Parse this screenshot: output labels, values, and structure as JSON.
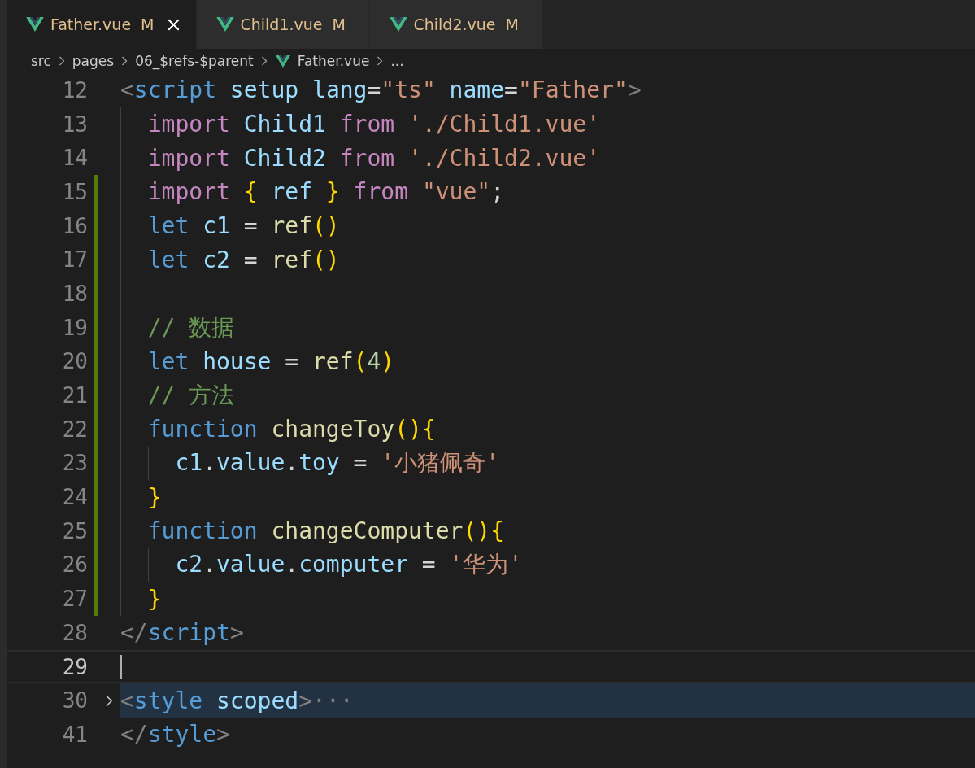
{
  "tabs": [
    {
      "label": "Father.vue",
      "status": "M",
      "selected": true,
      "closable": true
    },
    {
      "label": "Child1.vue",
      "status": "M",
      "selected": false,
      "closable": false
    },
    {
      "label": "Child2.vue",
      "status": "M",
      "selected": false,
      "closable": false
    }
  ],
  "breadcrumb": [
    {
      "label": "src",
      "kind": "folder"
    },
    {
      "label": "pages",
      "kind": "folder"
    },
    {
      "label": "06_$refs-$parent",
      "kind": "folder"
    },
    {
      "label": "Father.vue",
      "kind": "vue"
    },
    {
      "label": "...",
      "kind": "more"
    }
  ],
  "lines": [
    {
      "number": "12",
      "changed": false,
      "current": false,
      "folded": false,
      "tokens": [
        {
          "kind": "punct",
          "text": "<"
        },
        {
          "kind": "tag",
          "text": "script"
        },
        {
          "kind": "attr",
          "text": " setup"
        },
        {
          "kind": "attr",
          "text": " lang"
        },
        {
          "kind": "plain",
          "text": "="
        },
        {
          "kind": "string",
          "text": "\"ts\""
        },
        {
          "kind": "attr",
          "text": " name"
        },
        {
          "kind": "plain",
          "text": "="
        },
        {
          "kind": "string",
          "text": "\"Father\""
        },
        {
          "kind": "punct",
          "text": ">"
        }
      ],
      "children": [
        {
          "number": "13",
          "changed": false,
          "current": false,
          "folded": false,
          "tokens": [
            {
              "kind": "keyword",
              "text": "import"
            },
            {
              "kind": "var",
              "text": " Child1"
            },
            {
              "kind": "keyword",
              "text": " from"
            },
            {
              "kind": "string",
              "text": " './Child1.vue'"
            }
          ]
        },
        {
          "number": "14",
          "changed": false,
          "current": false,
          "folded": false,
          "tokens": [
            {
              "kind": "keyword",
              "text": "import"
            },
            {
              "kind": "var",
              "text": " Child2"
            },
            {
              "kind": "keyword",
              "text": " from"
            },
            {
              "kind": "string",
              "text": " './Child2.vue'"
            }
          ]
        },
        {
          "number": "15",
          "changed": true,
          "current": false,
          "folded": false,
          "tokens": [
            {
              "kind": "keyword",
              "text": "import"
            },
            {
              "kind": "bracket",
              "text": " {"
            },
            {
              "kind": "var",
              "text": " ref"
            },
            {
              "kind": "bracket",
              "text": " }"
            },
            {
              "kind": "keyword",
              "text": " from"
            },
            {
              "kind": "string",
              "text": " \"vue\""
            },
            {
              "kind": "plain",
              "text": ";"
            }
          ]
        },
        {
          "number": "16",
          "changed": true,
          "current": false,
          "folded": false,
          "tokens": [
            {
              "kind": "storage",
              "text": "let"
            },
            {
              "kind": "var",
              "text": " c1"
            },
            {
              "kind": "plain",
              "text": " = "
            },
            {
              "kind": "func",
              "text": "ref"
            },
            {
              "kind": "bracket",
              "text": "()"
            }
          ]
        },
        {
          "number": "17",
          "changed": true,
          "current": false,
          "folded": false,
          "tokens": [
            {
              "kind": "storage",
              "text": "let"
            },
            {
              "kind": "var",
              "text": " c2"
            },
            {
              "kind": "plain",
              "text": " = "
            },
            {
              "kind": "func",
              "text": "ref"
            },
            {
              "kind": "bracket",
              "text": "()"
            }
          ]
        },
        {
          "number": "18",
          "changed": true,
          "current": false,
          "folded": false
        },
        {
          "number": "19",
          "changed": true,
          "current": false,
          "folded": false,
          "tokens": [
            {
              "kind": "comment",
              "text": "// 数据"
            }
          ]
        },
        {
          "number": "20",
          "changed": true,
          "current": false,
          "folded": false,
          "tokens": [
            {
              "kind": "storage",
              "text": "let"
            },
            {
              "kind": "var",
              "text": " house"
            },
            {
              "kind": "plain",
              "text": " = "
            },
            {
              "kind": "func",
              "text": "ref"
            },
            {
              "kind": "bracket",
              "text": "("
            },
            {
              "kind": "number",
              "text": "4"
            },
            {
              "kind": "bracket",
              "text": ")"
            }
          ]
        },
        {
          "number": "21",
          "changed": true,
          "current": false,
          "folded": false,
          "tokens": [
            {
              "kind": "comment",
              "text": "// 方法"
            }
          ]
        },
        {
          "number": "22",
          "changed": true,
          "current": false,
          "folded": false,
          "tokens": [
            {
              "kind": "storage",
              "text": "function"
            },
            {
              "kind": "func",
              "text": " changeToy"
            },
            {
              "kind": "bracket",
              "text": "(){"
            }
          ],
          "children": [
            {
              "number": "23",
              "changed": true,
              "current": false,
              "folded": false,
              "tokens": [
                {
                  "kind": "var",
                  "text": "c1"
                },
                {
                  "kind": "plain",
                  "text": "."
                },
                {
                  "kind": "var",
                  "text": "value"
                },
                {
                  "kind": "plain",
                  "text": "."
                },
                {
                  "kind": "var",
                  "text": "toy"
                },
                {
                  "kind": "plain",
                  "text": " = "
                },
                {
                  "kind": "string",
                  "text": "'小猪佩奇'"
                }
              ]
            }
          ]
        },
        {
          "number": "24",
          "changed": true,
          "current": false,
          "folded": false,
          "tokens": [
            {
              "kind": "bracket",
              "text": "}"
            }
          ]
        },
        {
          "number": "25",
          "changed": true,
          "current": false,
          "folded": false,
          "tokens": [
            {
              "kind": "storage",
              "text": "function"
            },
            {
              "kind": "func",
              "text": " changeComputer"
            },
            {
              "kind": "bracket",
              "text": "(){"
            }
          ],
          "children": [
            {
              "number": "26",
              "changed": true,
              "current": false,
              "folded": false,
              "tokens": [
                {
                  "kind": "var",
                  "text": "c2"
                },
                {
                  "kind": "plain",
                  "text": "."
                },
                {
                  "kind": "var",
                  "text": "value"
                },
                {
                  "kind": "plain",
                  "text": "."
                },
                {
                  "kind": "var",
                  "text": "computer"
                },
                {
                  "kind": "plain",
                  "text": " = "
                },
                {
                  "kind": "string",
                  "text": "'华为'"
                }
              ]
            }
          ]
        },
        {
          "number": "27",
          "changed": true,
          "current": false,
          "folded": false,
          "tokens": [
            {
              "kind": "bracket",
              "text": "}"
            }
          ]
        }
      ]
    },
    {
      "number": "28",
      "changed": false,
      "current": false,
      "folded": false,
      "tokens": [
        {
          "kind": "punct",
          "text": "</"
        },
        {
          "kind": "tag",
          "text": "script"
        },
        {
          "kind": "punct",
          "text": ">"
        }
      ]
    },
    {
      "number": "29",
      "changed": false,
      "current": true,
      "folded": false
    },
    {
      "number": "30",
      "changed": false,
      "current": false,
      "folded": true,
      "tokens": [
        {
          "kind": "punct",
          "text": "<"
        },
        {
          "kind": "tag",
          "text": "style"
        },
        {
          "kind": "attr",
          "text": " scoped"
        },
        {
          "kind": "punct",
          "text": ">"
        },
        {
          "kind": "punct",
          "text": "···"
        }
      ]
    },
    {
      "number": "41",
      "changed": false,
      "current": false,
      "folded": false,
      "tokens": [
        {
          "kind": "punct",
          "text": "</"
        },
        {
          "kind": "tag",
          "text": "style"
        },
        {
          "kind": "punct",
          "text": ">"
        }
      ]
    }
  ]
}
